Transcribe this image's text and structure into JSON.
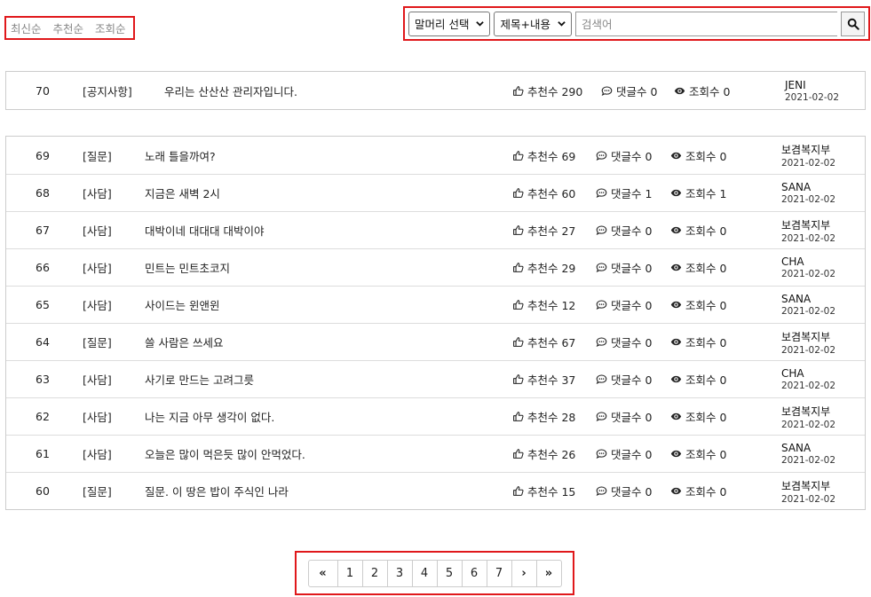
{
  "sort": [
    "최신순",
    "추천순",
    "조회순"
  ],
  "search": {
    "header_select": "말머리 선택",
    "field_select": "제목+내용",
    "placeholder": "검색어"
  },
  "notice": {
    "num": "70",
    "category": "[공지사항]",
    "title": "우리는 산산산 관리자입니다.",
    "likes": "추천수 290",
    "comments": "댓글수 0",
    "views": "조회수 0",
    "author": "JENI",
    "date": "2021-02-02"
  },
  "posts": [
    {
      "num": "69",
      "category": "[질문]",
      "title": "노래 틀을까여?",
      "likes": "추천수 69",
      "comments": "댓글수 0",
      "views": "조회수 0",
      "author": "보겸복지부",
      "date": "2021-02-02"
    },
    {
      "num": "68",
      "category": "[사담]",
      "title": "지금은 새벽 2시",
      "likes": "추천수 60",
      "comments": "댓글수 1",
      "views": "조회수 1",
      "author": "SANA",
      "date": "2021-02-02"
    },
    {
      "num": "67",
      "category": "[사담]",
      "title": "대박이네 대대대 대박이야",
      "likes": "추천수 27",
      "comments": "댓글수 0",
      "views": "조회수 0",
      "author": "보겸복지부",
      "date": "2021-02-02"
    },
    {
      "num": "66",
      "category": "[사담]",
      "title": "민트는 민트초코지",
      "likes": "추천수 29",
      "comments": "댓글수 0",
      "views": "조회수 0",
      "author": "CHA",
      "date": "2021-02-02"
    },
    {
      "num": "65",
      "category": "[사담]",
      "title": "사이드는 윈앤윈",
      "likes": "추천수 12",
      "comments": "댓글수 0",
      "views": "조회수 0",
      "author": "SANA",
      "date": "2021-02-02"
    },
    {
      "num": "64",
      "category": "[질문]",
      "title": "쓸 사람은 쓰세요",
      "likes": "추천수 67",
      "comments": "댓글수 0",
      "views": "조회수 0",
      "author": "보겸복지부",
      "date": "2021-02-02"
    },
    {
      "num": "63",
      "category": "[사담]",
      "title": "사기로 만드는 고려그릇",
      "likes": "추천수 37",
      "comments": "댓글수 0",
      "views": "조회수 0",
      "author": "CHA",
      "date": "2021-02-02"
    },
    {
      "num": "62",
      "category": "[사담]",
      "title": "나는 지금 아무 생각이 없다.",
      "likes": "추천수 28",
      "comments": "댓글수 0",
      "views": "조회수 0",
      "author": "보겸복지부",
      "date": "2021-02-02"
    },
    {
      "num": "61",
      "category": "[사담]",
      "title": "오늘은 많이 먹은듯 많이 안먹었다.",
      "likes": "추천수 26",
      "comments": "댓글수 0",
      "views": "조회수 0",
      "author": "SANA",
      "date": "2021-02-02"
    },
    {
      "num": "60",
      "category": "[질문]",
      "title": "질문. 이 땅은 밥이 주식인 나라",
      "likes": "추천수 15",
      "comments": "댓글수 0",
      "views": "조회수 0",
      "author": "보겸복지부",
      "date": "2021-02-02"
    }
  ],
  "pagination": {
    "first": "«",
    "pages": [
      "1",
      "2",
      "3",
      "4",
      "5",
      "6",
      "7"
    ],
    "next": "›",
    "last": "»"
  },
  "icons": {
    "like": "thumbs-up-icon",
    "comment": "comment-icon",
    "view": "eye-icon",
    "search": "search-icon"
  },
  "colors": {
    "highlight_border": "#e0181b"
  }
}
